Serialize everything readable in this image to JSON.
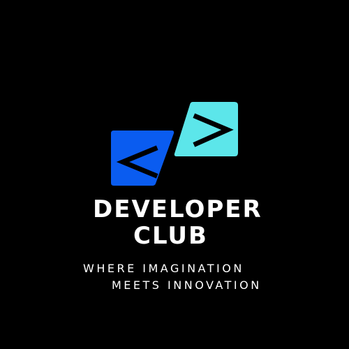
{
  "logo": {
    "title_line_1": "DEVELOPER",
    "title_line_2": "CLUB",
    "tagline_line_1": "WHERE IMAGINATION",
    "tagline_line_2": "MEETS INNOVATION",
    "left_glyph": "<",
    "right_glyph": ">",
    "icons": [
      "left-angle-bracket-icon",
      "right-angle-bracket-icon"
    ]
  },
  "colors": {
    "background": "#000000",
    "left_tile": "#0a5cf0",
    "right_tile": "#5ce6ea",
    "glyph": "#000000",
    "text": "#ffffff"
  }
}
